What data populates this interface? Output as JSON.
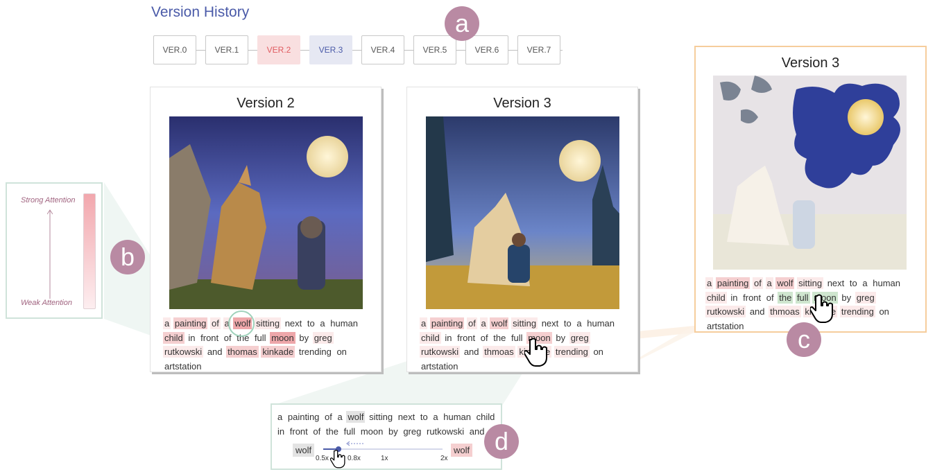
{
  "header": {
    "title": "Version History"
  },
  "versions": [
    "VER.0",
    "VER.1",
    "VER.2",
    "VER.3",
    "VER.4",
    "VER.5",
    "VER.6",
    "VER.7"
  ],
  "badges": {
    "a": "a",
    "b": "b",
    "c": "c",
    "d": "d"
  },
  "legend": {
    "strong": "Strong Attention",
    "weak": "Weak Attention"
  },
  "cards": {
    "v2": {
      "title": "Version 2",
      "words": [
        "a",
        "painting",
        "of",
        "a",
        "wolf",
        "sitting",
        "next",
        "to",
        "a",
        "human",
        "child",
        "in",
        "front",
        "of",
        "the",
        "full",
        "moon",
        "by",
        "greg",
        "rutkowski",
        "and",
        "thomas",
        "kinkade",
        "trending",
        "on",
        "artstation"
      ]
    },
    "v3": {
      "title": "Version 3",
      "words": [
        "a",
        "painting",
        "of",
        "a",
        "wolf",
        "sitting",
        "next",
        "to",
        "a",
        "human",
        "child",
        "in",
        "front",
        "of",
        "the",
        "full",
        "moon",
        "by",
        "greg",
        "rutkowski",
        "and",
        "thmoas",
        "kinkade",
        "trending",
        "on",
        "artstation"
      ]
    },
    "detail": {
      "title": "Version 3",
      "words": [
        "a",
        "painting",
        "of",
        "a",
        "wolf",
        "sitting",
        "next",
        "to",
        "a",
        "human",
        "child",
        "in",
        "front",
        "of",
        "the",
        "full",
        "moon",
        "by",
        "greg",
        "rutkowski",
        "and",
        "thmoas",
        "kinkade",
        "trending",
        "on",
        "artstation"
      ]
    }
  },
  "panel_d": {
    "line1": [
      "a",
      "painting",
      "of",
      "a",
      "wolf",
      "sitting",
      "next",
      "to",
      "a",
      "human",
      "child"
    ],
    "line2": [
      "in",
      "front",
      "of",
      "the",
      "full",
      "moon",
      "by",
      "greg",
      "rutkowski",
      "and"
    ],
    "left_token": "wolf",
    "right_token": "wolf",
    "ticks": [
      "0.5x",
      "0.8x",
      "1x",
      "2x"
    ]
  }
}
